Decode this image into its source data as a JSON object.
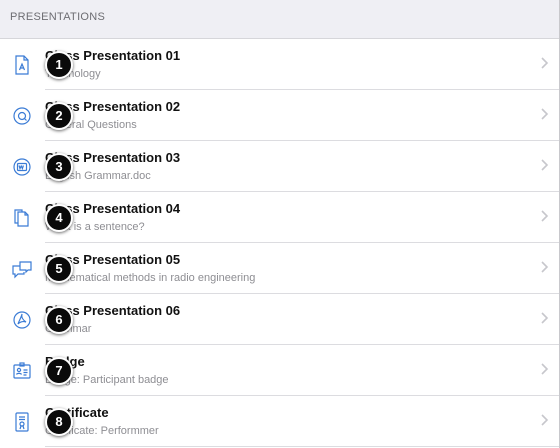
{
  "header": {
    "title": "PRESENTATIONS"
  },
  "colors": {
    "icon_blue": "#3a7bd5",
    "chevron": "#c7c7cc",
    "badge_bg": "#0a0a0a"
  },
  "items": [
    {
      "title": "Class Presentation 01",
      "subtitle": "Technology",
      "icon": "document-icon",
      "badge": "1"
    },
    {
      "title": "Class Presentation 02",
      "subtitle": "General Questions",
      "icon": "quiz-icon",
      "badge": "2"
    },
    {
      "title": "Class Presentation 03",
      "subtitle": "English Grammar.doc",
      "icon": "word-document-icon",
      "badge": "3"
    },
    {
      "title": "Class Presentation 04",
      "subtitle": "What is a sentence?",
      "icon": "copy-pages-icon",
      "badge": "4"
    },
    {
      "title": "Class Presentation 05",
      "subtitle": "Mathematical methods in radio engineering",
      "icon": "chat-bubbles-icon",
      "badge": "5"
    },
    {
      "title": "Class Presentation 06",
      "subtitle": "Grammar",
      "icon": "pdf-icon",
      "badge": "6"
    },
    {
      "title": "Badge",
      "subtitle": "Badge: Participant badge",
      "icon": "badge-card-icon",
      "badge": "7"
    },
    {
      "title": "Certificate",
      "subtitle": "Certificate: Performmer",
      "icon": "certificate-icon",
      "badge": "8"
    }
  ]
}
